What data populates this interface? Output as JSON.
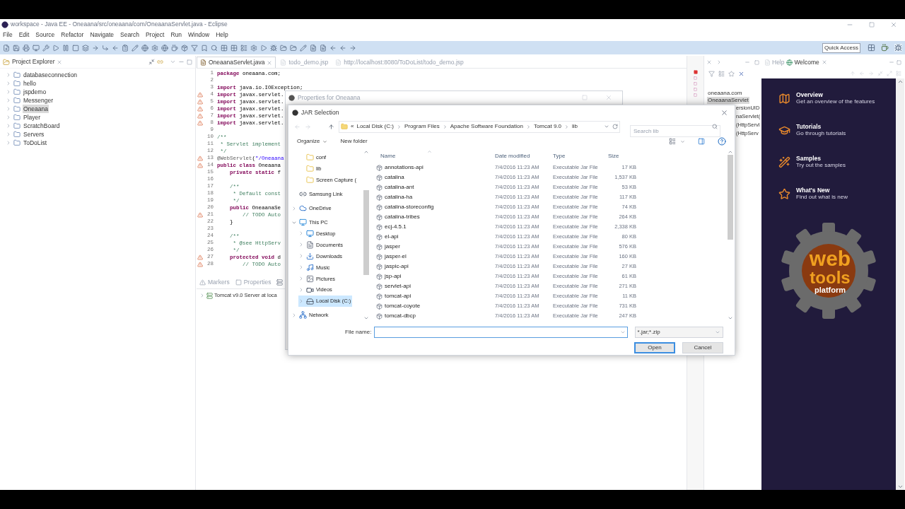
{
  "window": {
    "title": "workspace - Java EE - Oneaana/src/oneaana/com/OneaanaServlet.java - Eclipse"
  },
  "menu": [
    "File",
    "Edit",
    "Source",
    "Refactor",
    "Navigate",
    "Search",
    "Project",
    "Run",
    "Window",
    "Help"
  ],
  "quick_access": {
    "placeholder": "Quick Access"
  },
  "project_explorer": {
    "title": "Project Explorer",
    "items": [
      {
        "label": "databaseconnection",
        "selected": false
      },
      {
        "label": "hello",
        "selected": false
      },
      {
        "label": "jspdemo",
        "selected": false
      },
      {
        "label": "Messenger",
        "selected": false
      },
      {
        "label": "Oneaana",
        "selected": true
      },
      {
        "label": "Player",
        "selected": false
      },
      {
        "label": "ScratchBoard",
        "selected": false
      },
      {
        "label": "Servers",
        "selected": false
      },
      {
        "label": "ToDoList",
        "selected": false
      }
    ]
  },
  "editor": {
    "tabs": [
      {
        "label": "OneaanaServlet.java",
        "selected": true
      },
      {
        "label": "todo_demo.jsp",
        "selected": false
      },
      {
        "label": "http://localhost:8080/ToDoList/todo_demo.jsp",
        "selected": false
      }
    ],
    "lines": [
      {
        "number": "1",
        "marker": false,
        "segments": [
          {
            "text": "package",
            "kind": "keyword"
          },
          {
            "text": " oneaana.com;",
            "kind": "plain"
          }
        ]
      },
      {
        "number": "2",
        "marker": false
      },
      {
        "number": "3",
        "marker": false,
        "segments": [
          {
            "text": "import",
            "kind": "keyword"
          },
          {
            "text": " java.io.IOException;",
            "kind": "plain"
          }
        ]
      },
      {
        "number": "4",
        "marker": true,
        "segments": [
          {
            "text": "import",
            "kind": "keyword"
          },
          {
            "text": " javax.servlet.",
            "kind": "plain"
          }
        ]
      },
      {
        "number": "5",
        "marker": true,
        "segments": [
          {
            "text": "import",
            "kind": "keyword"
          },
          {
            "text": " javax.servlet.",
            "kind": "plain"
          }
        ]
      },
      {
        "number": "6",
        "marker": true,
        "segments": [
          {
            "text": "import",
            "kind": "keyword"
          },
          {
            "text": " javax.servlet.",
            "kind": "plain"
          }
        ]
      },
      {
        "number": "7",
        "marker": true,
        "segments": [
          {
            "text": "import",
            "kind": "keyword"
          },
          {
            "text": " javax.servlet.",
            "kind": "plain"
          }
        ]
      },
      {
        "number": "8",
        "marker": true,
        "segments": [
          {
            "text": "import",
            "kind": "keyword"
          },
          {
            "text": " javax.servlet.",
            "kind": "plain"
          }
        ]
      },
      {
        "number": "9",
        "marker": false
      },
      {
        "number": "10",
        "marker": false,
        "segments": [
          {
            "text": "/**",
            "kind": "comment"
          }
        ]
      },
      {
        "number": "11",
        "marker": false,
        "segments": [
          {
            "text": " * Servlet implement",
            "kind": "comment"
          }
        ]
      },
      {
        "number": "12",
        "marker": false,
        "segments": [
          {
            "text": " */",
            "kind": "comment"
          }
        ]
      },
      {
        "number": "13",
        "marker": true,
        "segments": [
          {
            "text": "@WebServlet",
            "kind": "annotation"
          },
          {
            "text": "(",
            "kind": "plain"
          },
          {
            "text": "\"/Oneaana",
            "kind": "string"
          }
        ]
      },
      {
        "number": "14",
        "marker": true,
        "segments": [
          {
            "text": "public class",
            "kind": "keyword"
          },
          {
            "text": " Oneaana",
            "kind": "plain"
          }
        ]
      },
      {
        "number": "15",
        "marker": false,
        "segments": [
          {
            "text": "    private static",
            "kind": "keyword"
          },
          {
            "text": " f",
            "kind": "plain"
          }
        ]
      },
      {
        "number": "16",
        "marker": false
      },
      {
        "number": "17",
        "marker": false,
        "segments": [
          {
            "text": "    /**",
            "kind": "comment"
          }
        ]
      },
      {
        "number": "18",
        "marker": false,
        "segments": [
          {
            "text": "     * Default const",
            "kind": "comment"
          }
        ]
      },
      {
        "number": "19",
        "marker": false,
        "segments": [
          {
            "text": "     */",
            "kind": "comment"
          }
        ]
      },
      {
        "number": "20",
        "marker": false,
        "segments": [
          {
            "text": "    public",
            "kind": "keyword"
          },
          {
            "text": " OneaanaSe",
            "kind": "plain"
          }
        ]
      },
      {
        "number": "21",
        "marker": true,
        "segments": [
          {
            "text": "        // TODO Auto",
            "kind": "comment"
          }
        ]
      },
      {
        "number": "22",
        "marker": false,
        "segments": [
          {
            "text": "    }",
            "kind": "plain"
          }
        ]
      },
      {
        "number": "23",
        "marker": false
      },
      {
        "number": "24",
        "marker": false,
        "segments": [
          {
            "text": "    /**",
            "kind": "comment"
          }
        ]
      },
      {
        "number": "25",
        "marker": false,
        "segments": [
          {
            "text": "     * @see HttpServ",
            "kind": "comment"
          }
        ]
      },
      {
        "number": "26",
        "marker": false,
        "segments": [
          {
            "text": "     */",
            "kind": "comment"
          }
        ]
      },
      {
        "number": "27",
        "marker": true,
        "segments": [
          {
            "text": "    protected void",
            "kind": "keyword"
          },
          {
            "text": " d",
            "kind": "plain"
          }
        ]
      },
      {
        "number": "28",
        "marker": true,
        "segments": [
          {
            "text": "        // TODO Auto",
            "kind": "comment"
          }
        ]
      }
    ]
  },
  "bottom_panel": {
    "tabs": [
      {
        "label": "Markers",
        "selected": false
      },
      {
        "label": "Properties",
        "selected": false
      }
    ],
    "rows": [
      "Tomcat v9.0 Server at loca"
    ]
  },
  "outline": {
    "items": [
      {
        "label": "oneaana.com",
        "selected": false
      },
      {
        "label": "OneaanaServlet",
        "selected": true
      }
    ],
    "fragments": [
      "ersionUID",
      "naServlet(",
      "(HttpServl",
      "(HttpServ"
    ]
  },
  "welcome": {
    "tabs": [
      {
        "label": "Help",
        "selected": false
      },
      {
        "label": "Welcome",
        "selected": true
      }
    ],
    "items": [
      {
        "kind": "map",
        "title": "Overview",
        "subtitle": "Get an overview of the features"
      },
      {
        "kind": "cap",
        "title": "Tutorials",
        "subtitle": "Go through tutorials"
      },
      {
        "kind": "wand",
        "title": "Samples",
        "subtitle": "Try out the samples"
      },
      {
        "kind": "star",
        "title": "What's New",
        "subtitle": "Find out what is new"
      }
    ],
    "logo": [
      "web",
      "tools",
      "platform"
    ]
  },
  "properties_window": {
    "title": "Properties for Oneaana"
  },
  "jar_dialog": {
    "title": "JAR Selection",
    "path": [
      "«",
      "Local Disk (C:)",
      "Program Files",
      "Apache Software Foundation",
      "Tomcat 9.0",
      "lib"
    ],
    "search": {
      "placeholder": "Search lib"
    },
    "toolbar": [
      "Organize",
      "New folder"
    ],
    "nav": [
      {
        "label": "conf",
        "kind": "folder",
        "selected": false
      },
      {
        "label": "lib",
        "kind": "folder",
        "selected": false
      },
      {
        "label": "Screen Capture (",
        "kind": "folder",
        "selected": false
      },
      {
        "label": "Samsung Link",
        "kind": "link",
        "selected": false
      },
      {
        "label": "OneDrive",
        "kind": "cloud",
        "expanded": false,
        "selected": false
      },
      {
        "label": "This PC",
        "kind": "pc",
        "expanded": true,
        "selected": false,
        "children": [
          {
            "label": "Desktop",
            "kind": "desktop",
            "expanded": false,
            "selected": false
          },
          {
            "label": "Documents",
            "kind": "documents",
            "expanded": false,
            "selected": false
          },
          {
            "label": "Downloads",
            "kind": "downloads",
            "expanded": false,
            "selected": false
          },
          {
            "label": "Music",
            "kind": "music",
            "expanded": false,
            "selected": false
          },
          {
            "label": "Pictures",
            "kind": "pictures",
            "expanded": false,
            "selected": false
          },
          {
            "label": "Videos",
            "kind": "videos",
            "expanded": false,
            "selected": false
          },
          {
            "label": "Local Disk (C:)",
            "kind": "disk",
            "expanded": false,
            "selected": true
          }
        ]
      },
      {
        "label": "Network",
        "kind": "network",
        "expanded": false,
        "selected": false
      }
    ],
    "columns": [
      "Name",
      "Date modified",
      "Type",
      "Size"
    ],
    "files": [
      {
        "name": "annotations-api",
        "date": "7/4/2016 11:23 AM",
        "type": "Executable Jar File",
        "size": "17 KB"
      },
      {
        "name": "catalina",
        "date": "7/4/2016 11:23 AM",
        "type": "Executable Jar File",
        "size": "1,537 KB"
      },
      {
        "name": "catalina-ant",
        "date": "7/4/2016 11:23 AM",
        "type": "Executable Jar File",
        "size": "53 KB"
      },
      {
        "name": "catalina-ha",
        "date": "7/4/2016 11:23 AM",
        "type": "Executable Jar File",
        "size": "117 KB"
      },
      {
        "name": "catalina-storeconfig",
        "date": "7/4/2016 11:23 AM",
        "type": "Executable Jar File",
        "size": "74 KB"
      },
      {
        "name": "catalina-tribes",
        "date": "7/4/2016 11:23 AM",
        "type": "Executable Jar File",
        "size": "264 KB"
      },
      {
        "name": "ecj-4.5.1",
        "date": "7/4/2016 11:23 AM",
        "type": "Executable Jar File",
        "size": "2,338 KB"
      },
      {
        "name": "el-api",
        "date": "7/4/2016 11:23 AM",
        "type": "Executable Jar File",
        "size": "80 KB"
      },
      {
        "name": "jasper",
        "date": "7/4/2016 11:23 AM",
        "type": "Executable Jar File",
        "size": "576 KB"
      },
      {
        "name": "jasper-el",
        "date": "7/4/2016 11:23 AM",
        "type": "Executable Jar File",
        "size": "160 KB"
      },
      {
        "name": "jaspic-api",
        "date": "7/4/2016 11:23 AM",
        "type": "Executable Jar File",
        "size": "27 KB"
      },
      {
        "name": "jsp-api",
        "date": "7/4/2016 11:23 AM",
        "type": "Executable Jar File",
        "size": "61 KB"
      },
      {
        "name": "servlet-api",
        "date": "7/4/2016 11:23 AM",
        "type": "Executable Jar File",
        "size": "271 KB"
      },
      {
        "name": "tomcat-api",
        "date": "7/4/2016 11:23 AM",
        "type": "Executable Jar File",
        "size": "11 KB"
      },
      {
        "name": "tomcat-coyote",
        "date": "7/4/2016 11:23 AM",
        "type": "Executable Jar File",
        "size": "731 KB"
      },
      {
        "name": "tomcat-dbcp",
        "date": "7/4/2016 11:23 AM",
        "type": "Executable Jar File",
        "size": "247 KB"
      }
    ],
    "file_name": {
      "label": "File name:"
    },
    "filter": "*.jar;*.zip",
    "buttons": [
      {
        "label": "Open",
        "kind": "primary"
      },
      {
        "label": "Cancel",
        "kind": "normal"
      }
    ]
  }
}
